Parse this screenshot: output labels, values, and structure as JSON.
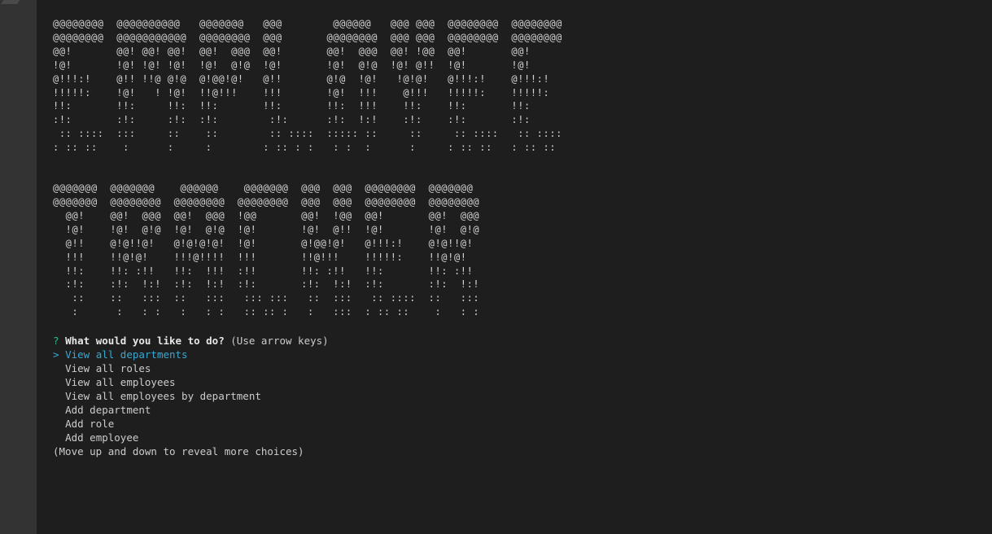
{
  "banner": {
    "title_lines": [
      "@@@@@@@@  @@@@@@@@@@   @@@@@@@   @@@        @@@@@@   @@@ @@@  @@@@@@@@  @@@@@@@@",
      "@@@@@@@@  @@@@@@@@@@@  @@@@@@@@  @@@       @@@@@@@@  @@@ @@@  @@@@@@@@  @@@@@@@@",
      "@@!       @@! @@! @@!  @@!  @@@  @@!       @@!  @@@  @@! !@@  @@!       @@!",
      "!@!       !@! !@! !@!  !@!  @!@  !@!       !@!  @!@  !@! @!!  !@!       !@!",
      "@!!!:!    @!! !!@ @!@  @!@@!@!   @!!       @!@  !@!   !@!@!   @!!!:!    @!!!:!",
      "!!!!!:    !@!   ! !@!  !!@!!!    !!!       !@!  !!!    @!!!   !!!!!:    !!!!!:",
      "!!:       !!:     !!:  !!:       !!:       !!:  !!!    !!:    !!:       !!:",
      ":!:       :!:     :!:  :!:        :!:      :!:  !:!    :!:    :!:       :!:",
      " :: ::::  :::     ::    ::        :: ::::  ::::: ::     ::     :: ::::   :: ::::",
      ": :: ::    :      :     :        : :: : :   : :  :      :     : :: ::   : :: ::"
    ],
    "subtitle_lines": [
      "@@@@@@@  @@@@@@@    @@@@@@    @@@@@@@  @@@  @@@  @@@@@@@@  @@@@@@@",
      "@@@@@@@  @@@@@@@@  @@@@@@@@  @@@@@@@@  @@@  @@@  @@@@@@@@  @@@@@@@@",
      "  @@!    @@!  @@@  @@!  @@@  !@@       @@!  !@@  @@!       @@!  @@@",
      "  !@!    !@!  @!@  !@!  @!@  !@!       !@!  @!!  !@!       !@!  @!@",
      "  @!!    @!@!!@!   @!@!@!@!  !@!       @!@@!@!   @!!!:!    @!@!!@!",
      "  !!!    !!@!@!    !!!@!!!!  !!!       !!@!!!    !!!!!:    !!@!@!",
      "  !!:    !!: :!!   !!:  !!!  :!!       !!: :!!   !!:       !!: :!!",
      "  :!:    :!:  !:!  :!:  !:!  :!:       :!:  !:!  :!:       :!:  !:!",
      "   ::    ::   :::  ::   :::   ::: :::   ::  :::   :: ::::  ::   :::",
      "   :      :   : :   :   : :   :: :: :   :   :::  : :: ::    :   : :"
    ]
  },
  "prompt": {
    "qmark": "?",
    "question": "What would you like to do?",
    "hint": "(Use arrow keys)",
    "pointer": ">",
    "choices": [
      "View all departments",
      "View all roles",
      "View all employees",
      "View all employees by department",
      "Add department",
      "Add role",
      "Add employee"
    ],
    "more_hint": "(Move up and down to reveal more choices)"
  },
  "colors": {
    "background": "#1e1e1e",
    "gutter": "#333333",
    "text": "#cccccc",
    "qmark": "#2fb98e",
    "selected": "#3aa7d1"
  }
}
